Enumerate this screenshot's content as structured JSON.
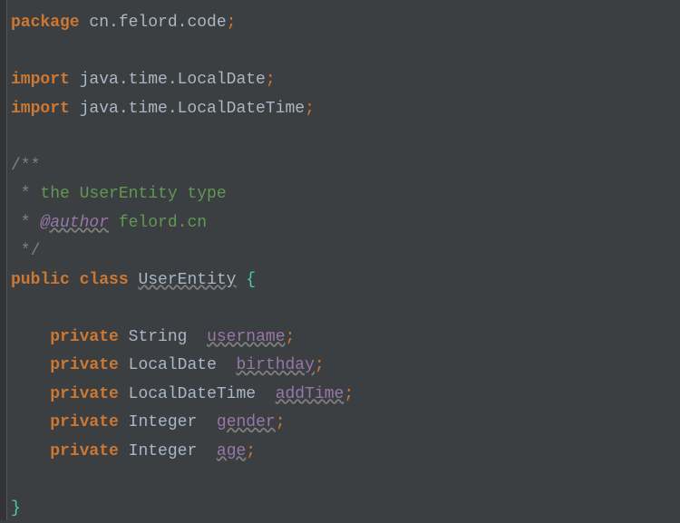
{
  "code": {
    "package_kw": "package",
    "package_name": " cn.felord.code",
    "import_kw": "import",
    "import1": " java.time.LocalDate",
    "import2": " java.time.LocalDateTime",
    "doc_start": "/**",
    "doc_line1_prefix": " * ",
    "doc_line1_text": "the UserEntity type",
    "doc_line2_prefix": " * ",
    "doc_author_tag": "@author",
    "doc_author_text": " felord.cn",
    "doc_end": " */",
    "public_kw": "public",
    "class_kw": "class",
    "class_name": "UserEntity",
    "open_brace": "{",
    "private_kw": "private",
    "type_string": "String",
    "type_localdate": "LocalDate",
    "type_localdatetime": "LocalDateTime",
    "type_integer": "Integer",
    "field_username": "username",
    "field_birthday": "birthday",
    "field_addtime": "addTime",
    "field_gender": "gender",
    "field_age": "age",
    "close_brace": "}",
    "semi": ";"
  }
}
